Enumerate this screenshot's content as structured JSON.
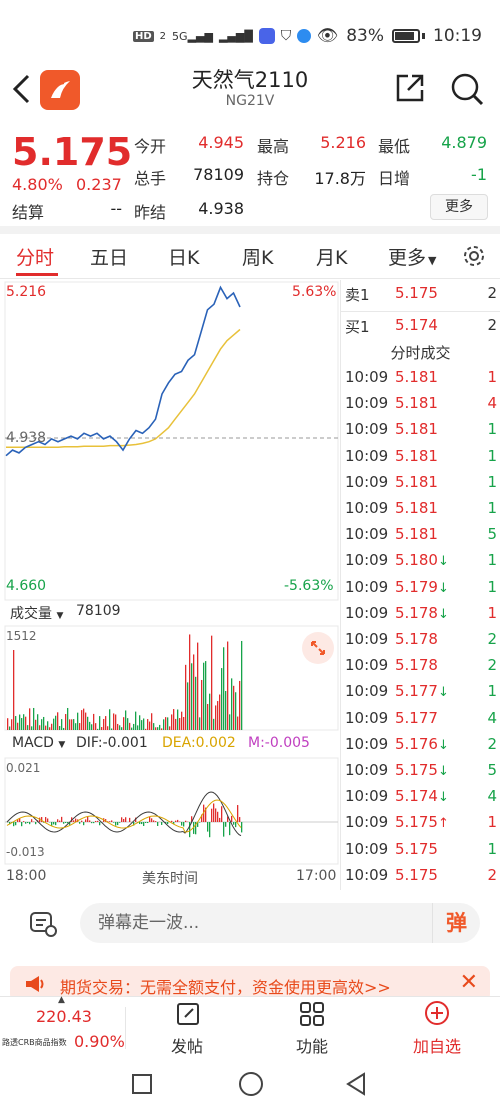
{
  "status_bar": {
    "left_icons": [
      "HD",
      "2",
      "5G",
      "4G"
    ],
    "battery": "83%",
    "time": "10:19"
  },
  "header": {
    "title": "天然气2110",
    "subtitle": "NG21V"
  },
  "quote": {
    "price": "5.175",
    "change_pct": "4.80%",
    "change_abs": "0.237",
    "rows": [
      [
        {
          "label": "今开",
          "value": "4.945",
          "color": "red"
        },
        {
          "label": "最高",
          "value": "5.216",
          "color": "red"
        },
        {
          "label": "最低",
          "value": "4.879",
          "color": "green"
        }
      ],
      [
        {
          "label": "总手",
          "value": "78109",
          "color": "dark"
        },
        {
          "label": "持仓",
          "value": "17.8万",
          "color": "dark"
        },
        {
          "label": "日增",
          "value": "-1",
          "color": "green"
        }
      ],
      [
        {
          "label": "结算",
          "value": "--",
          "color": "dark"
        },
        {
          "label": "昨结",
          "value": "4.938",
          "color": "dark"
        }
      ]
    ],
    "more_label": "更多"
  },
  "tabs": {
    "items": [
      "分时",
      "五日",
      "日K",
      "周K",
      "月K",
      "更多"
    ],
    "active_index": 0
  },
  "chart": {
    "price_high": "5.216",
    "price_high_pct": "5.63%",
    "price_mid": "4.938",
    "price_low": "4.660",
    "price_low_pct": "-5.63%",
    "volume_label": "成交量",
    "volume_value": "78109",
    "volume_max": "1512",
    "macd_label": "MACD",
    "dif": "DIF:-0.001",
    "dea": "DEA:0.002",
    "m": "M:-0.005",
    "macd_top": "0.021",
    "macd_bottom": "-0.013",
    "time_start": "18:00",
    "time_mid": "美东时间",
    "time_end": "17:00"
  },
  "chart_data": {
    "type": "line",
    "title": "",
    "ylim": [
      4.66,
      5.216
    ],
    "series": [
      {
        "values": [
          4.91,
          4.92,
          4.915,
          4.925,
          4.93,
          4.935,
          4.93,
          4.94,
          4.935,
          4.94,
          4.945,
          4.94,
          4.95,
          4.945,
          4.95,
          4.94,
          4.945,
          4.935,
          4.92,
          4.94,
          4.955,
          4.95,
          4.96,
          4.975,
          5.02,
          5.04,
          5.055,
          5.06,
          5.08,
          5.09,
          5.13,
          5.17,
          5.18,
          5.21,
          5.19,
          5.2,
          5.175
        ]
      },
      {
        "values": [
          4.925,
          4.925,
          4.925,
          4.925,
          4.925,
          4.925,
          4.925,
          4.925,
          4.925,
          4.926,
          4.926,
          4.926,
          4.927,
          4.927,
          4.927,
          4.927,
          4.928,
          4.928,
          4.928,
          4.929,
          4.93,
          4.932,
          4.935,
          4.94,
          4.95,
          4.96,
          4.975,
          4.99,
          5.005,
          5.02,
          5.04,
          5.06,
          5.08,
          5.1,
          5.115,
          5.125,
          5.135
        ]
      }
    ]
  },
  "order_book": {
    "asks": [
      {
        "label": "卖1",
        "price": "5.175",
        "qty": "2"
      }
    ],
    "bids": [
      {
        "label": "买1",
        "price": "5.174",
        "qty": "2"
      }
    ],
    "trades_title": "分时成交"
  },
  "trades": [
    {
      "time": "10:09",
      "price": "5.181",
      "arrow": "",
      "qty": "1",
      "qty_color": "red"
    },
    {
      "time": "10:09",
      "price": "5.181",
      "arrow": "",
      "qty": "4",
      "qty_color": "red"
    },
    {
      "time": "10:09",
      "price": "5.181",
      "arrow": "",
      "qty": "1",
      "qty_color": "green"
    },
    {
      "time": "10:09",
      "price": "5.181",
      "arrow": "",
      "qty": "1",
      "qty_color": "green"
    },
    {
      "time": "10:09",
      "price": "5.181",
      "arrow": "",
      "qty": "1",
      "qty_color": "green"
    },
    {
      "time": "10:09",
      "price": "5.181",
      "arrow": "",
      "qty": "1",
      "qty_color": "green"
    },
    {
      "time": "10:09",
      "price": "5.181",
      "arrow": "",
      "qty": "5",
      "qty_color": "green"
    },
    {
      "time": "10:09",
      "price": "5.180",
      "arrow": "↓",
      "qty": "1",
      "qty_color": "green"
    },
    {
      "time": "10:09",
      "price": "5.179",
      "arrow": "↓",
      "qty": "1",
      "qty_color": "green"
    },
    {
      "time": "10:09",
      "price": "5.178",
      "arrow": "↓",
      "qty": "1",
      "qty_color": "red"
    },
    {
      "time": "10:09",
      "price": "5.178",
      "arrow": "",
      "qty": "2",
      "qty_color": "green"
    },
    {
      "time": "10:09",
      "price": "5.178",
      "arrow": "",
      "qty": "2",
      "qty_color": "green"
    },
    {
      "time": "10:09",
      "price": "5.177",
      "arrow": "↓",
      "qty": "1",
      "qty_color": "green"
    },
    {
      "time": "10:09",
      "price": "5.177",
      "arrow": "",
      "qty": "4",
      "qty_color": "green"
    },
    {
      "time": "10:09",
      "price": "5.176",
      "arrow": "↓",
      "qty": "2",
      "qty_color": "green"
    },
    {
      "time": "10:09",
      "price": "5.175",
      "arrow": "↓",
      "qty": "5",
      "qty_color": "green"
    },
    {
      "time": "10:09",
      "price": "5.174",
      "arrow": "↓",
      "qty": "4",
      "qty_color": "green"
    },
    {
      "time": "10:09",
      "price": "5.175",
      "arrow": "↑",
      "qty": "1",
      "qty_color": "red"
    },
    {
      "time": "10:09",
      "price": "5.175",
      "arrow": "",
      "qty": "1",
      "qty_color": "green"
    },
    {
      "time": "10:09",
      "price": "5.175",
      "arrow": "",
      "qty": "2",
      "qty_color": "red"
    }
  ],
  "danmu": {
    "placeholder": "弹幕走一波...",
    "button": "弹"
  },
  "ad": {
    "text": "期货交易：无需全额支付，资金使用更高效>>"
  },
  "bottom_nav": {
    "index_value": "220.43",
    "index_name": "路透CRB商品指数",
    "index_pct": "0.90%",
    "items": [
      "发帖",
      "功能",
      "加自选"
    ]
  },
  "colors": {
    "red": "#e12c2c",
    "green": "#17a34a",
    "accent": "#f0592a",
    "price_line": "#2a62b8",
    "avg_line": "#e8c13a"
  }
}
